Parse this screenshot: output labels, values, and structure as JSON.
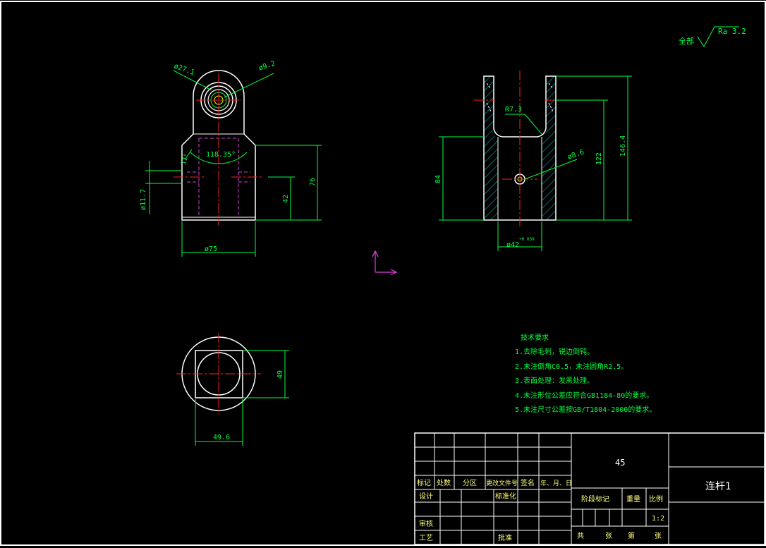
{
  "surface_finish": {
    "prefix": "全部",
    "value": "Ra 3.2"
  },
  "front_view": {
    "dims": {
      "d_outer": "ø27.1",
      "d_hole": "ø9.2",
      "angle": "118.35°",
      "angle_small": "11°",
      "d_body": "ø11.7",
      "width": "ø75",
      "h42": "42",
      "h76": "76"
    }
  },
  "side_view": {
    "dims": {
      "radius": "R7.3",
      "d_pin": "ø8.6",
      "h84": "84",
      "h122": "122",
      "h146": "146.4",
      "bore": "ø42",
      "tol": "+0.039"
    }
  },
  "top_view": {
    "dims": {
      "width": "49.6",
      "height": "49"
    }
  },
  "tech_requirements": {
    "title": "技术要求",
    "items": [
      "1.去除毛刺，锐边倒钝。",
      "2.未注倒角C0.5，未注圆角R2.5。",
      "3.表面处理：发黑处理。",
      "4.未注形位公差应符合GB1184-80的要求。",
      "5.未注尺寸公差按GB/T1804-2000的要求。"
    ]
  },
  "title_block": {
    "material": "45",
    "part_name": "连杆1",
    "headers": [
      "标记",
      "处数",
      "分区",
      "更改文件号",
      "签名",
      "年、月、日"
    ],
    "row_design": "设计",
    "row_standard": "标准化",
    "row_check": "审核",
    "row_process": "工艺",
    "row_approve": "批准",
    "stage_mark": "阶段标记",
    "weight": "重量",
    "scale": "比例",
    "scale_value": "1:2",
    "total": "共",
    "sheets": "张",
    "page": "第",
    "sheet2": "张"
  }
}
